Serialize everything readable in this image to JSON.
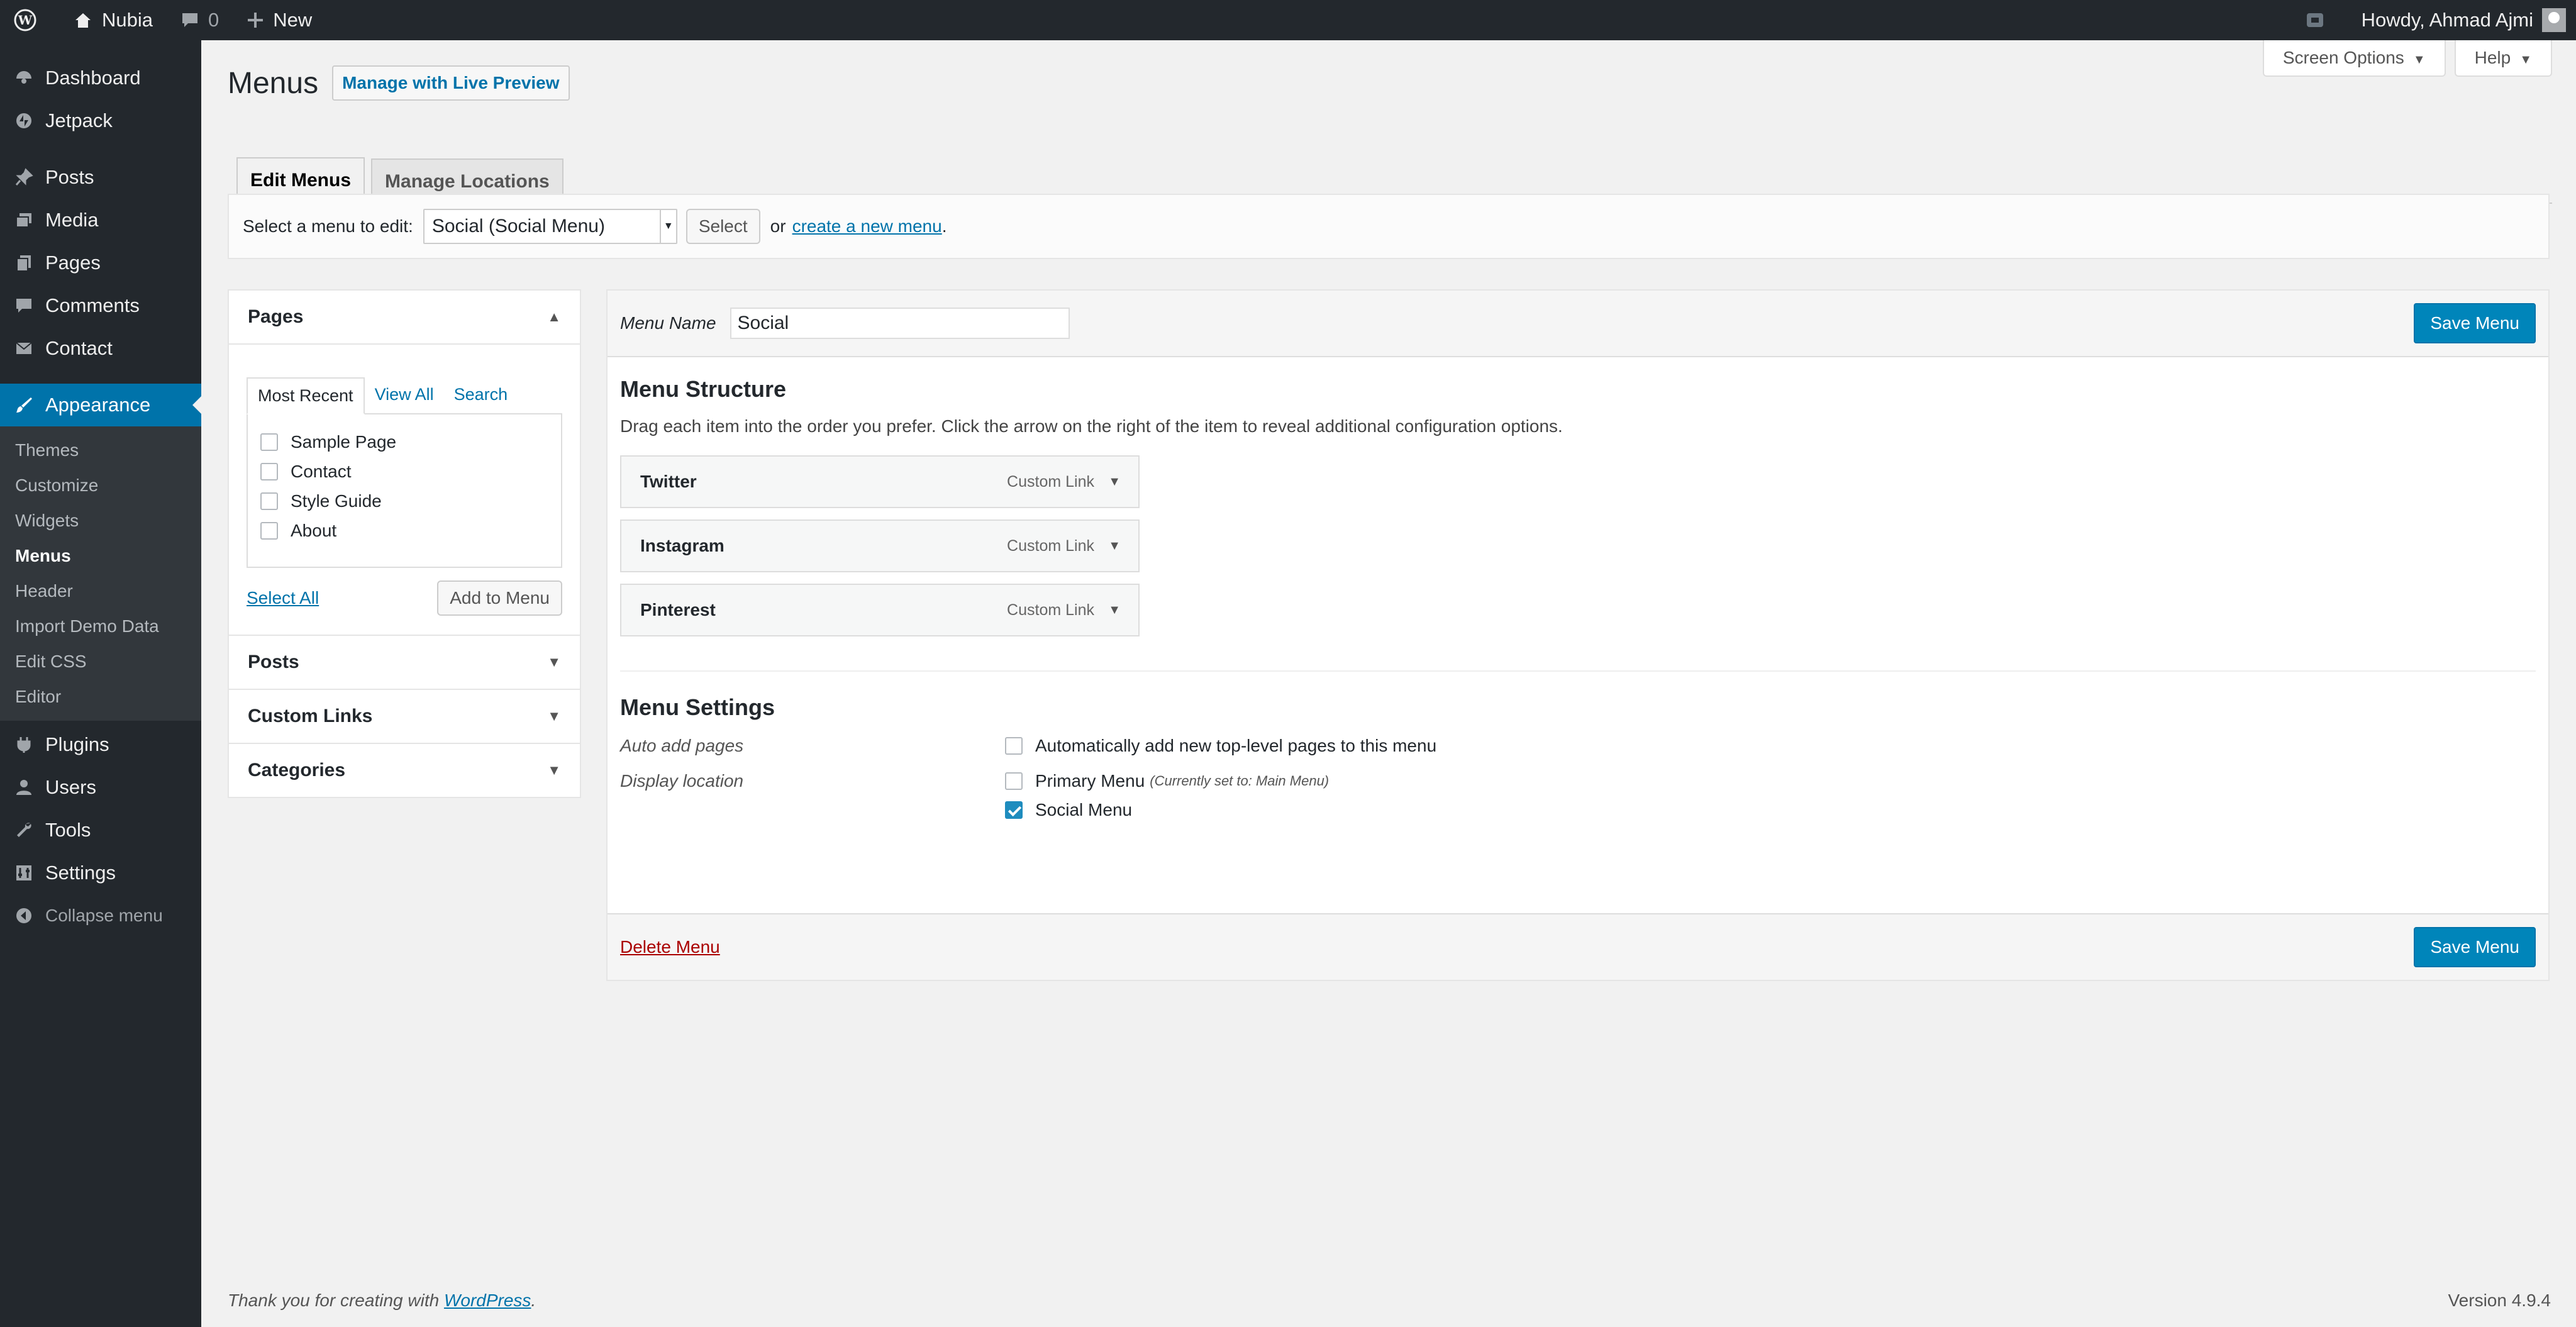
{
  "adminbar": {
    "site_name": "Nubia",
    "comments_count": "0",
    "new_label": "New",
    "greeting": "Howdy, Ahmad Ajmi"
  },
  "sidebar": {
    "items_top": [
      {
        "label": "Dashboard",
        "icon": "dashboard-icon"
      },
      {
        "label": "Jetpack",
        "icon": "jetpack-icon"
      }
    ],
    "items_mid": [
      {
        "label": "Posts",
        "icon": "pin-icon"
      },
      {
        "label": "Media",
        "icon": "media-icon"
      },
      {
        "label": "Pages",
        "icon": "pages-icon"
      },
      {
        "label": "Comments",
        "icon": "comment-icon"
      },
      {
        "label": "Contact",
        "icon": "mail-icon"
      }
    ],
    "appearance": "Appearance",
    "submenu": [
      "Themes",
      "Customize",
      "Widgets",
      "Menus",
      "Header",
      "Import Demo Data",
      "Edit CSS",
      "Editor"
    ],
    "items_bottom": [
      {
        "label": "Plugins",
        "icon": "plugins-icon"
      },
      {
        "label": "Users",
        "icon": "users-icon"
      },
      {
        "label": "Tools",
        "icon": "tools-icon"
      },
      {
        "label": "Settings",
        "icon": "settings-icon"
      }
    ],
    "collapse": "Collapse menu"
  },
  "header": {
    "title": "Menus",
    "live_preview": "Manage with Live Preview",
    "screen_options": "Screen Options",
    "help": "Help"
  },
  "tabs": [
    "Edit Menus",
    "Manage Locations"
  ],
  "select_bar": {
    "label": "Select a menu to edit:",
    "selected": "Social (Social Menu)",
    "select_button": "Select",
    "or": "or",
    "create_link": "create a new menu"
  },
  "left": {
    "pages_title": "Pages",
    "inner_tabs": [
      "Most Recent",
      "View All",
      "Search"
    ],
    "pages": [
      "Sample Page",
      "Contact",
      "Style Guide",
      "About"
    ],
    "select_all": "Select All",
    "add_to_menu": "Add to Menu",
    "accordions": [
      "Posts",
      "Custom Links",
      "Categories"
    ]
  },
  "right": {
    "menu_name_label": "Menu Name",
    "menu_name_value": "Social",
    "save_button": "Save Menu",
    "structure_title": "Menu Structure",
    "structure_desc": "Drag each item into the order you prefer. Click the arrow on the right of the item to reveal additional configuration options.",
    "menu_items": [
      {
        "title": "Twitter",
        "type": "Custom Link"
      },
      {
        "title": "Instagram",
        "type": "Custom Link"
      },
      {
        "title": "Pinterest",
        "type": "Custom Link"
      }
    ],
    "settings_title": "Menu Settings",
    "auto_add_label": "Auto add pages",
    "auto_add_text": "Automatically add new top-level pages to this menu",
    "display_label": "Display location",
    "primary_menu": "Primary Menu",
    "primary_note": "(Currently set to: Main Menu)",
    "social_menu": "Social Menu",
    "delete_link": "Delete Menu"
  },
  "footer": {
    "thanks_prefix": "Thank you for creating with ",
    "wp_link": "WordPress",
    "thanks_suffix": ".",
    "version": "Version 4.9.4"
  }
}
